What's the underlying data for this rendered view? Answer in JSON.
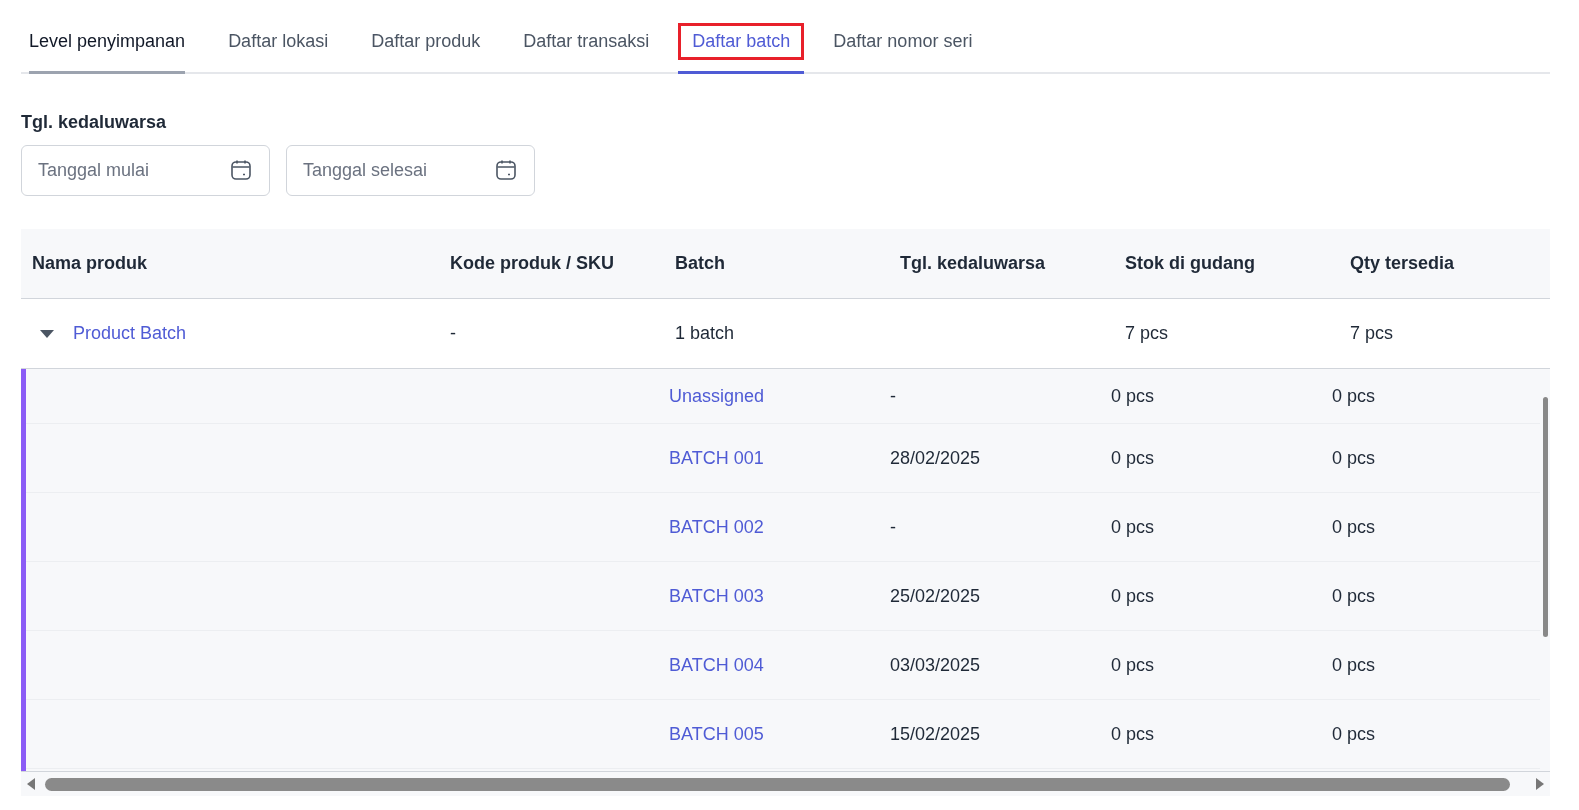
{
  "tabs": [
    {
      "label": "Level penyimpanan",
      "selected": false,
      "highlighted": false
    },
    {
      "label": "Daftar lokasi",
      "selected": false,
      "highlighted": false
    },
    {
      "label": "Daftar produk",
      "selected": false,
      "highlighted": false
    },
    {
      "label": "Daftar transaksi",
      "selected": false,
      "highlighted": false
    },
    {
      "label": "Daftar batch",
      "selected": true,
      "highlighted": true
    },
    {
      "label": "Daftar nomor seri",
      "selected": false,
      "highlighted": false
    }
  ],
  "filter": {
    "label": "Tgl. kedaluwarsa",
    "fields": [
      {
        "placeholder": "Tanggal mulai"
      },
      {
        "placeholder": "Tanggal selesai"
      }
    ]
  },
  "table": {
    "columns": [
      "Nama produk",
      "Kode produk / SKU",
      "Batch",
      "Tgl. kedaluwarsa",
      "Stok di gudang",
      "Qty tersedia"
    ],
    "rows": [
      {
        "name": "Product Batch",
        "sku": "-",
        "batch": "1 batch",
        "stock": "7 pcs",
        "available": "7 pcs",
        "expanded": true,
        "children": [
          {
            "batch": "Unassigned",
            "expiry": "-",
            "stock": "0 pcs",
            "available": "0 pcs"
          },
          {
            "batch": "BATCH 001",
            "expiry": "28/02/2025",
            "stock": "0 pcs",
            "available": "0 pcs"
          },
          {
            "batch": "BATCH 002",
            "expiry": "-",
            "stock": "0 pcs",
            "available": "0 pcs"
          },
          {
            "batch": "BATCH 003",
            "expiry": "25/02/2025",
            "stock": "0 pcs",
            "available": "0 pcs"
          },
          {
            "batch": "BATCH 004",
            "expiry": "03/03/2025",
            "stock": "0 pcs",
            "available": "0 pcs"
          },
          {
            "batch": "BATCH 005",
            "expiry": "15/02/2025",
            "stock": "0 pcs",
            "available": "0 pcs"
          }
        ]
      }
    ]
  }
}
